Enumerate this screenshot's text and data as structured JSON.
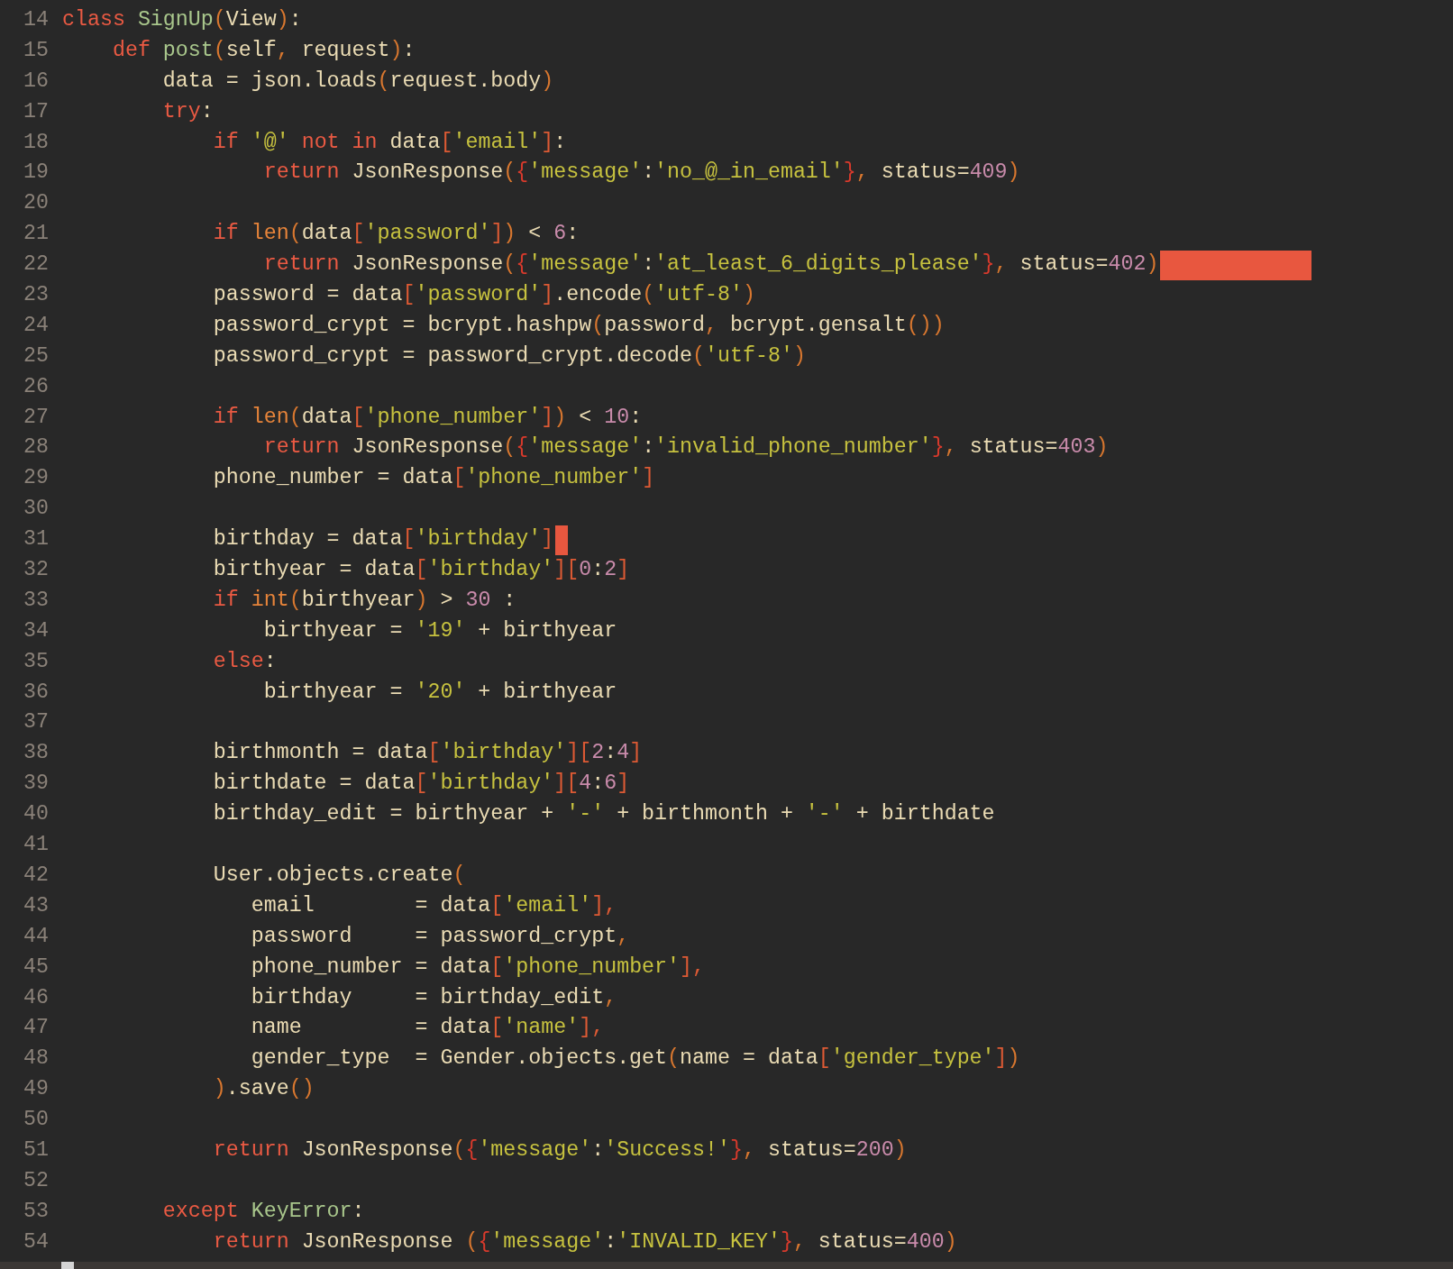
{
  "editor": {
    "lines": [
      {
        "number": "14",
        "tokens": [
          {
            "kind": "keyword",
            "text": "class "
          },
          {
            "kind": "name",
            "text": "SignUp"
          },
          {
            "kind": "paren",
            "text": "("
          },
          {
            "kind": "plain",
            "text": "View"
          },
          {
            "kind": "paren",
            "text": ")"
          },
          {
            "kind": "plain",
            "text": ":"
          }
        ]
      },
      {
        "number": "15",
        "tokens": [
          {
            "kind": "keyword",
            "text": "    def "
          },
          {
            "kind": "name",
            "text": "post"
          },
          {
            "kind": "paren",
            "text": "("
          },
          {
            "kind": "plain",
            "text": "self"
          },
          {
            "kind": "paren",
            "text": ","
          },
          {
            "kind": "plain",
            "text": " request"
          },
          {
            "kind": "paren",
            "text": ")"
          },
          {
            "kind": "plain",
            "text": ":"
          }
        ]
      },
      {
        "number": "16",
        "tokens": [
          {
            "kind": "plain",
            "text": "        data = json.loads"
          },
          {
            "kind": "paren",
            "text": "("
          },
          {
            "kind": "plain",
            "text": "request.body"
          },
          {
            "kind": "paren",
            "text": ")"
          }
        ]
      },
      {
        "number": "17",
        "tokens": [
          {
            "kind": "keyword",
            "text": "        try"
          },
          {
            "kind": "plain",
            "text": ":"
          }
        ]
      },
      {
        "number": "18",
        "tokens": [
          {
            "kind": "keyword",
            "text": "            if "
          },
          {
            "kind": "string",
            "text": "'@'"
          },
          {
            "kind": "keyword",
            "text": " not in"
          },
          {
            "kind": "plain",
            "text": " data"
          },
          {
            "kind": "bracket",
            "text": "["
          },
          {
            "kind": "string",
            "text": "'email'"
          },
          {
            "kind": "bracket",
            "text": "]"
          },
          {
            "kind": "plain",
            "text": ":"
          }
        ]
      },
      {
        "number": "19",
        "tokens": [
          {
            "kind": "keyword",
            "text": "                return"
          },
          {
            "kind": "plain",
            "text": " JsonResponse"
          },
          {
            "kind": "paren",
            "text": "("
          },
          {
            "kind": "brace",
            "text": "{"
          },
          {
            "kind": "string",
            "text": "'message'"
          },
          {
            "kind": "plain",
            "text": ":"
          },
          {
            "kind": "string",
            "text": "'no_@_in_email'"
          },
          {
            "kind": "brace",
            "text": "}"
          },
          {
            "kind": "paren",
            "text": ","
          },
          {
            "kind": "plain",
            "text": " status="
          },
          {
            "kind": "number",
            "text": "409"
          },
          {
            "kind": "paren",
            "text": ")"
          }
        ]
      },
      {
        "number": "20"
      },
      {
        "number": "21",
        "tokens": [
          {
            "kind": "keyword",
            "text": "            if "
          },
          {
            "kind": "builtin",
            "text": "len"
          },
          {
            "kind": "paren",
            "text": "("
          },
          {
            "kind": "plain",
            "text": "data"
          },
          {
            "kind": "bracket",
            "text": "["
          },
          {
            "kind": "string",
            "text": "'password'"
          },
          {
            "kind": "bracket",
            "text": "]"
          },
          {
            "kind": "paren",
            "text": ")"
          },
          {
            "kind": "plain",
            "text": " < "
          },
          {
            "kind": "number",
            "text": "6"
          },
          {
            "kind": "plain",
            "text": ":"
          }
        ]
      },
      {
        "number": "22",
        "marker": {
          "kind": "redaction"
        },
        "tokens": [
          {
            "kind": "keyword",
            "text": "                return"
          },
          {
            "kind": "plain",
            "text": " JsonResponse"
          },
          {
            "kind": "paren",
            "text": "("
          },
          {
            "kind": "brace",
            "text": "{"
          },
          {
            "kind": "string",
            "text": "'message'"
          },
          {
            "kind": "plain",
            "text": ":"
          },
          {
            "kind": "string",
            "text": "'at_least_6_digits_please'"
          },
          {
            "kind": "brace",
            "text": "}"
          },
          {
            "kind": "paren",
            "text": ","
          },
          {
            "kind": "plain",
            "text": " status="
          },
          {
            "kind": "number",
            "text": "402"
          },
          {
            "kind": "paren",
            "text": ")"
          }
        ]
      },
      {
        "number": "23",
        "tokens": [
          {
            "kind": "plain",
            "text": "            password = data"
          },
          {
            "kind": "bracket",
            "text": "["
          },
          {
            "kind": "string",
            "text": "'password'"
          },
          {
            "kind": "bracket",
            "text": "]"
          },
          {
            "kind": "plain",
            "text": ".encode"
          },
          {
            "kind": "paren",
            "text": "("
          },
          {
            "kind": "string",
            "text": "'utf-8'"
          },
          {
            "kind": "paren",
            "text": ")"
          }
        ]
      },
      {
        "number": "24",
        "tokens": [
          {
            "kind": "plain",
            "text": "            password_crypt = bcrypt.hashpw"
          },
          {
            "kind": "paren",
            "text": "("
          },
          {
            "kind": "plain",
            "text": "password"
          },
          {
            "kind": "paren",
            "text": ","
          },
          {
            "kind": "plain",
            "text": " bcrypt.gensalt"
          },
          {
            "kind": "paren",
            "text": "())"
          }
        ]
      },
      {
        "number": "25",
        "tokens": [
          {
            "kind": "plain",
            "text": "            password_crypt = password_crypt.decode"
          },
          {
            "kind": "paren",
            "text": "("
          },
          {
            "kind": "string",
            "text": "'utf-8'"
          },
          {
            "kind": "paren",
            "text": ")"
          }
        ]
      },
      {
        "number": "26"
      },
      {
        "number": "27",
        "tokens": [
          {
            "kind": "keyword",
            "text": "            if "
          },
          {
            "kind": "builtin",
            "text": "len"
          },
          {
            "kind": "paren",
            "text": "("
          },
          {
            "kind": "plain",
            "text": "data"
          },
          {
            "kind": "bracket",
            "text": "["
          },
          {
            "kind": "string",
            "text": "'phone_number'"
          },
          {
            "kind": "bracket",
            "text": "]"
          },
          {
            "kind": "paren",
            "text": ")"
          },
          {
            "kind": "plain",
            "text": " < "
          },
          {
            "kind": "number",
            "text": "10"
          },
          {
            "kind": "plain",
            "text": ":"
          }
        ]
      },
      {
        "number": "28",
        "tokens": [
          {
            "kind": "keyword",
            "text": "                return"
          },
          {
            "kind": "plain",
            "text": " JsonResponse"
          },
          {
            "kind": "paren",
            "text": "("
          },
          {
            "kind": "brace",
            "text": "{"
          },
          {
            "kind": "string",
            "text": "'message'"
          },
          {
            "kind": "plain",
            "text": ":"
          },
          {
            "kind": "string",
            "text": "'invalid_phone_number'"
          },
          {
            "kind": "brace",
            "text": "}"
          },
          {
            "kind": "paren",
            "text": ","
          },
          {
            "kind": "plain",
            "text": " status="
          },
          {
            "kind": "number",
            "text": "403"
          },
          {
            "kind": "paren",
            "text": ")"
          }
        ]
      },
      {
        "number": "29",
        "tokens": [
          {
            "kind": "plain",
            "text": "            phone_number = data"
          },
          {
            "kind": "bracket",
            "text": "["
          },
          {
            "kind": "string",
            "text": "'phone_number'"
          },
          {
            "kind": "bracket",
            "text": "]"
          }
        ]
      },
      {
        "number": "30"
      },
      {
        "number": "31",
        "marker": {
          "kind": "cursor"
        },
        "tokens": [
          {
            "kind": "plain",
            "text": "            birthday = data"
          },
          {
            "kind": "bracket",
            "text": "["
          },
          {
            "kind": "string",
            "text": "'birthday'"
          },
          {
            "kind": "bracket",
            "text": "]"
          }
        ]
      },
      {
        "number": "32",
        "tokens": [
          {
            "kind": "plain",
            "text": "            birthyear = data"
          },
          {
            "kind": "bracket",
            "text": "["
          },
          {
            "kind": "string",
            "text": "'birthday'"
          },
          {
            "kind": "bracket",
            "text": "]["
          },
          {
            "kind": "number",
            "text": "0"
          },
          {
            "kind": "plain",
            "text": ":"
          },
          {
            "kind": "number",
            "text": "2"
          },
          {
            "kind": "bracket",
            "text": "]"
          }
        ]
      },
      {
        "number": "33",
        "tokens": [
          {
            "kind": "keyword",
            "text": "            if "
          },
          {
            "kind": "builtin",
            "text": "int"
          },
          {
            "kind": "paren",
            "text": "("
          },
          {
            "kind": "plain",
            "text": "birthyear"
          },
          {
            "kind": "paren",
            "text": ")"
          },
          {
            "kind": "plain",
            "text": " > "
          },
          {
            "kind": "number",
            "text": "30"
          },
          {
            "kind": "plain",
            "text": " :"
          }
        ]
      },
      {
        "number": "34",
        "tokens": [
          {
            "kind": "plain",
            "text": "                birthyear = "
          },
          {
            "kind": "string",
            "text": "'19'"
          },
          {
            "kind": "plain",
            "text": " + birthyear"
          }
        ]
      },
      {
        "number": "35",
        "tokens": [
          {
            "kind": "keyword",
            "text": "            else"
          },
          {
            "kind": "plain",
            "text": ":"
          }
        ]
      },
      {
        "number": "36",
        "tokens": [
          {
            "kind": "plain",
            "text": "                birthyear = "
          },
          {
            "kind": "string",
            "text": "'20'"
          },
          {
            "kind": "plain",
            "text": " + birthyear"
          }
        ]
      },
      {
        "number": "37"
      },
      {
        "number": "38",
        "tokens": [
          {
            "kind": "plain",
            "text": "            birthmonth = data"
          },
          {
            "kind": "bracket",
            "text": "["
          },
          {
            "kind": "string",
            "text": "'birthday'"
          },
          {
            "kind": "bracket",
            "text": "]["
          },
          {
            "kind": "number",
            "text": "2"
          },
          {
            "kind": "plain",
            "text": ":"
          },
          {
            "kind": "number",
            "text": "4"
          },
          {
            "kind": "bracket",
            "text": "]"
          }
        ]
      },
      {
        "number": "39",
        "tokens": [
          {
            "kind": "plain",
            "text": "            birthdate = data"
          },
          {
            "kind": "bracket",
            "text": "["
          },
          {
            "kind": "string",
            "text": "'birthday'"
          },
          {
            "kind": "bracket",
            "text": "]["
          },
          {
            "kind": "number",
            "text": "4"
          },
          {
            "kind": "plain",
            "text": ":"
          },
          {
            "kind": "number",
            "text": "6"
          },
          {
            "kind": "bracket",
            "text": "]"
          }
        ]
      },
      {
        "number": "40",
        "tokens": [
          {
            "kind": "plain",
            "text": "            birthday_edit = birthyear + "
          },
          {
            "kind": "string",
            "text": "'-'"
          },
          {
            "kind": "plain",
            "text": " + birthmonth + "
          },
          {
            "kind": "string",
            "text": "'-'"
          },
          {
            "kind": "plain",
            "text": " + birthdate"
          }
        ]
      },
      {
        "number": "41"
      },
      {
        "number": "42",
        "tokens": [
          {
            "kind": "plain",
            "text": "            User.objects.create"
          },
          {
            "kind": "paren",
            "text": "("
          }
        ]
      },
      {
        "number": "43",
        "tokens": [
          {
            "kind": "plain",
            "text": "               email        = data"
          },
          {
            "kind": "bracket",
            "text": "["
          },
          {
            "kind": "string",
            "text": "'email'"
          },
          {
            "kind": "bracket",
            "text": "],"
          }
        ]
      },
      {
        "number": "44",
        "tokens": [
          {
            "kind": "plain",
            "text": "               password     = password_crypt"
          },
          {
            "kind": "paren",
            "text": ","
          }
        ]
      },
      {
        "number": "45",
        "tokens": [
          {
            "kind": "plain",
            "text": "               phone_number = data"
          },
          {
            "kind": "bracket",
            "text": "["
          },
          {
            "kind": "string",
            "text": "'phone_number'"
          },
          {
            "kind": "bracket",
            "text": "],"
          }
        ]
      },
      {
        "number": "46",
        "tokens": [
          {
            "kind": "plain",
            "text": "               birthday     = birthday_edit"
          },
          {
            "kind": "paren",
            "text": ","
          }
        ]
      },
      {
        "number": "47",
        "tokens": [
          {
            "kind": "plain",
            "text": "               name         = data"
          },
          {
            "kind": "bracket",
            "text": "["
          },
          {
            "kind": "string",
            "text": "'name'"
          },
          {
            "kind": "bracket",
            "text": "],"
          }
        ]
      },
      {
        "number": "48",
        "tokens": [
          {
            "kind": "plain",
            "text": "               gender_type  = Gender.objects.get"
          },
          {
            "kind": "paren",
            "text": "("
          },
          {
            "kind": "plain",
            "text": "name = data"
          },
          {
            "kind": "bracket",
            "text": "["
          },
          {
            "kind": "string",
            "text": "'gender_type'"
          },
          {
            "kind": "bracket",
            "text": "]"
          },
          {
            "kind": "paren",
            "text": ")"
          }
        ]
      },
      {
        "number": "49",
        "tokens": [
          {
            "kind": "paren",
            "text": "            )"
          },
          {
            "kind": "plain",
            "text": ".save"
          },
          {
            "kind": "paren",
            "text": "()"
          }
        ]
      },
      {
        "number": "50"
      },
      {
        "number": "51",
        "tokens": [
          {
            "kind": "keyword",
            "text": "            return"
          },
          {
            "kind": "plain",
            "text": " JsonResponse"
          },
          {
            "kind": "paren",
            "text": "("
          },
          {
            "kind": "brace",
            "text": "{"
          },
          {
            "kind": "string",
            "text": "'message'"
          },
          {
            "kind": "plain",
            "text": ":"
          },
          {
            "kind": "string",
            "text": "'Success!'"
          },
          {
            "kind": "brace",
            "text": "}"
          },
          {
            "kind": "paren",
            "text": ","
          },
          {
            "kind": "plain",
            "text": " status="
          },
          {
            "kind": "number",
            "text": "200"
          },
          {
            "kind": "paren",
            "text": ")"
          }
        ]
      },
      {
        "number": "52"
      },
      {
        "number": "53",
        "tokens": [
          {
            "kind": "keyword",
            "text": "        except "
          },
          {
            "kind": "name",
            "text": "KeyError"
          },
          {
            "kind": "plain",
            "text": ":"
          }
        ]
      },
      {
        "number": "54",
        "tokens": [
          {
            "kind": "keyword",
            "text": "            return"
          },
          {
            "kind": "plain",
            "text": " JsonResponse "
          },
          {
            "kind": "paren",
            "text": "("
          },
          {
            "kind": "brace",
            "text": "{"
          },
          {
            "kind": "string",
            "text": "'message'"
          },
          {
            "kind": "plain",
            "text": ":"
          },
          {
            "kind": "string",
            "text": "'INVALID_KEY'"
          },
          {
            "kind": "brace",
            "text": "}"
          },
          {
            "kind": "paren",
            "text": ","
          },
          {
            "kind": "plain",
            "text": " status="
          },
          {
            "kind": "number",
            "text": "400"
          },
          {
            "kind": "paren",
            "text": ")"
          }
        ]
      }
    ]
  }
}
